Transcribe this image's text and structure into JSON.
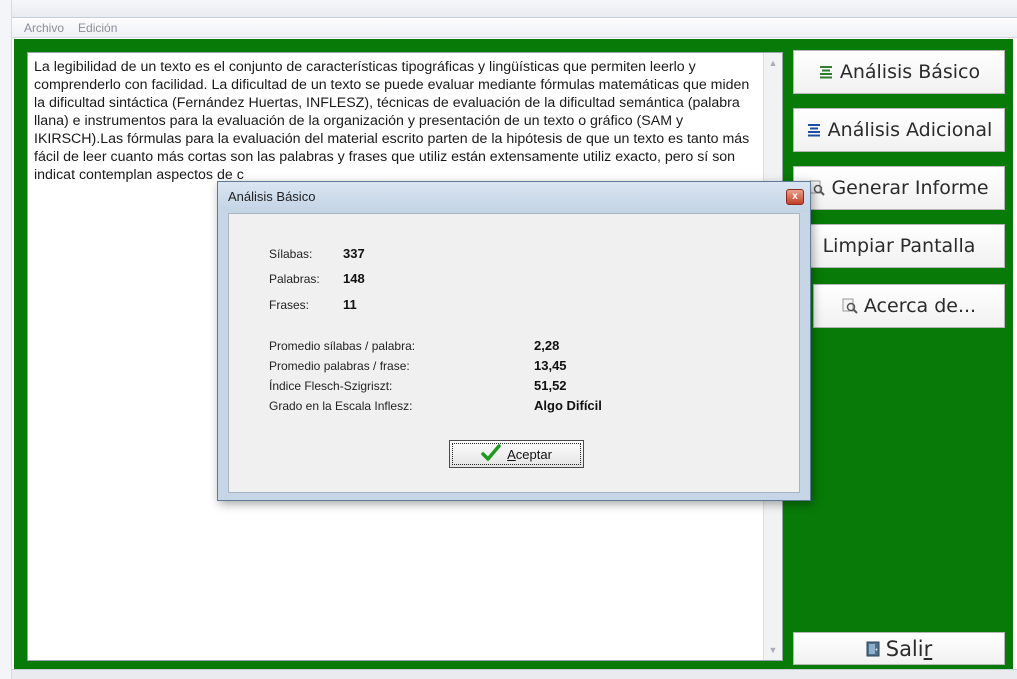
{
  "menu": {
    "file": "Archivo",
    "edit": "Edición"
  },
  "document": {
    "text": "La legibilidad de un texto es el conjunto de características tipográficas y lingüísticas que permiten leerlo y comprenderlo con facilidad. La dificultad de un texto se puede evaluar mediante fórmulas matemáticas que miden la dificultad sintáctica (Fernández Huertas, INFLESZ), técnicas de evaluación de la dificultad semántica (palabra llana) e instrumentos para la evaluación de la organización y presentación de un texto o gráfico (SAM y IKIRSCH).Las fórmulas para la evaluación del material escrito parten de la hipótesis de que un texto es tanto más fácil de leer cuanto más cortas son las palabras y frases que utiliz están extensamente utiliz exacto, pero sí son indicat contemplan aspectos de c"
  },
  "buttons": {
    "basic": "Análisis Básico",
    "extra": "Análisis Adicional",
    "report": "Generar Informe",
    "clear": "Limpiar Pantalla",
    "about": "Acerca de...",
    "exit_prefix": "Sali",
    "exit_mnemonic": "r"
  },
  "dialog": {
    "title": "Análisis Básico",
    "close": "x",
    "syllables_label": "Sílabas:",
    "syllables_value": "337",
    "words_label": "Palabras:",
    "words_value": "148",
    "sentences_label": "Frases:",
    "sentences_value": "11",
    "avg_syl_label": "Promedio sílabas / palabra:",
    "avg_syl_value": "2,28",
    "avg_words_label": "Promedio palabras / frase:",
    "avg_words_value": "13,45",
    "flesch_label": "Índice Flesch-Szigriszt:",
    "flesch_value": "51,52",
    "grade_label": "Grado en la Escala Inflesz:",
    "grade_value": "Algo Difícil",
    "ok_mnemonic": "A",
    "ok_rest": "ceptar"
  },
  "colors": {
    "panel_green": "#087a08",
    "check_green": "#1e9a1e",
    "icon_green": "#2f7d2f",
    "icon_blue": "#1c4fa3"
  },
  "icons": {
    "basic": "list-lines-icon",
    "extra": "list-lines-icon",
    "report": "magnifier-icon",
    "clear": "",
    "about": "magnifier-icon",
    "exit": "door-icon",
    "ok": "checkmark-icon"
  }
}
